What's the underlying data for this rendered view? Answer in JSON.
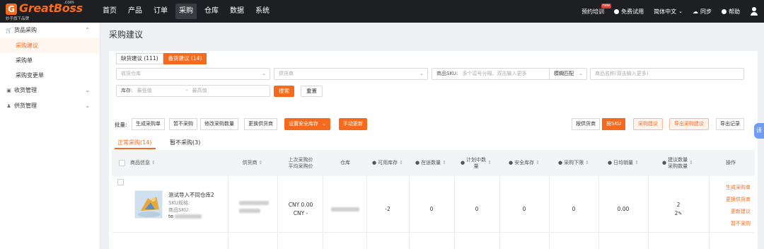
{
  "brand": {
    "logo_letter": "G",
    "name": "GreatBoss",
    "com": ".com",
    "tagline": "妙手旗下品牌"
  },
  "nav": {
    "items": [
      "首页",
      "产品",
      "订单",
      "采购",
      "仓库",
      "数据",
      "系统"
    ],
    "active": "采购"
  },
  "top_right": {
    "training": "预约培训",
    "training_badge": "new",
    "free_trial": "免费试用",
    "language": "简体中文",
    "sync": "同步",
    "help": "帮助"
  },
  "sidebar": {
    "groups": [
      {
        "label": "货品采购",
        "icon": "cart-icon",
        "chevron": "^",
        "items": [
          "采购建议",
          "采购单",
          "采购变更单"
        ],
        "active": "采购建议"
      },
      {
        "label": "收货管理",
        "icon": "box-icon",
        "chevron": "v",
        "items": []
      },
      {
        "label": "供货管理",
        "icon": "people-icon",
        "chevron": "v",
        "items": []
      }
    ]
  },
  "page": {
    "title": "采购建议"
  },
  "filter": {
    "tabs": [
      "缺货建议 (111)",
      "备货建议 (14)"
    ],
    "active_tab": "备货建议 (14)",
    "warehouse_placeholder": "收货仓库",
    "supplier_placeholder": "供货商",
    "sku_label": "商品SKU:",
    "sku_placeholder": "多个逗号分隔、双击输入更多",
    "match_mode": "模糊匹配",
    "product_name_placeholder": "商品名称(双击输入更多)",
    "stock_label": "库存:",
    "stock_min_placeholder": "最低值",
    "stock_max_placeholder": "最高值",
    "stock_separator": "-",
    "search_button": "搜索",
    "reset_button": "重置"
  },
  "toolbar": {
    "batch_label": "批量:",
    "generate_po": "生成采购单",
    "pause_purchase": "暂不采购",
    "modify_qty": "修改采购数量",
    "change_supplier": "更换供货商",
    "set_safety_stock": "设置安全库存",
    "manual_update": "手动更新",
    "by_supplier": "按供货商",
    "by_sku": "按SKU",
    "purchase_advice": "采购建议",
    "export_advice": "导出采购建议",
    "export_log": "导出记录"
  },
  "subtabs": {
    "normal": "正常采购(14)",
    "paused": "暂不采购(3)"
  },
  "table": {
    "headers": {
      "product_info": "商品信息",
      "supplier": "供货商",
      "last_price_1": "上次采购价",
      "last_price_2": "平均采购价",
      "warehouse": "仓库",
      "available_stock": "可用库存",
      "in_transit": "在途数量",
      "planned_1": "计划中数",
      "planned_2": "量",
      "safety_stock": "安全库存",
      "purchase_lower": "采购下限",
      "daily_sales": "日均销量",
      "suggested_1": "建议数量",
      "suggested_2": "采购数量",
      "actions": "操作"
    },
    "rows": [
      {
        "product_name": "测试导入不同仓库2",
        "sku_spec_label": "SKU规格:",
        "product_sku_label": "商品SKU:",
        "sku_value_prefix": "te",
        "last_price": "CNY 0.00",
        "avg_price": "CNY -",
        "available_stock": "-2",
        "in_transit": "0",
        "planned": "0",
        "safety_stock": "0",
        "purchase_lower": "0",
        "daily_sales": "0.00",
        "suggested_qty": "2",
        "purchase_qty": "2",
        "actions": [
          "生成采购单",
          "更换供货商",
          "更新建议",
          "暂不采购"
        ]
      }
    ]
  },
  "float_tab": "译",
  "colors": {
    "accent": "#f56a1c",
    "topbar": "#1e1f23",
    "float_tab": "#6f9cf4"
  }
}
